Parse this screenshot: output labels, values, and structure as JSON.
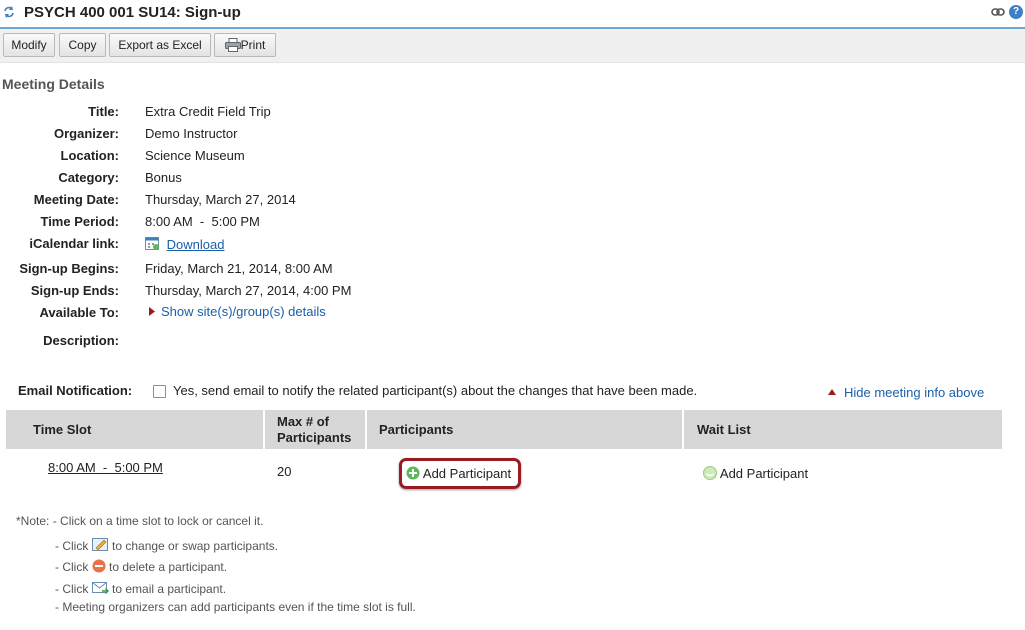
{
  "header": {
    "title": "PSYCH 400 001 SU14: Sign-up"
  },
  "toolbar": {
    "modify": "Modify",
    "copy": "Copy",
    "export": "Export as Excel",
    "print": "Print"
  },
  "details": {
    "section_title": "Meeting Details",
    "rows": [
      {
        "label": "Title:",
        "value": "Extra Credit Field Trip"
      },
      {
        "label": "Organizer:",
        "value": "Demo Instructor"
      },
      {
        "label": "Location:",
        "value": "Science Museum"
      },
      {
        "label": "Category:",
        "value": "Bonus"
      },
      {
        "label": "Meeting Date:",
        "value": "Thursday, March 27, 2014"
      },
      {
        "label": "Time Period:",
        "value": "8:00 AM  -  5:00 PM"
      },
      {
        "label": "iCalendar link:",
        "value": "Download"
      },
      {
        "label": "Sign-up Begins:",
        "value": "Friday, March 21, 2014, 8:00 AM"
      },
      {
        "label": "Sign-up Ends:",
        "value": "Thursday, March 27, 2014, 4:00 PM"
      },
      {
        "label": "Available To:",
        "value": "Show site(s)/group(s) details"
      },
      {
        "label": "Description:",
        "value": ""
      }
    ]
  },
  "email": {
    "label": "Email Notification:",
    "checkbox_text": "Yes, send email to notify the related participant(s) about the changes that have been made.",
    "checked": false
  },
  "hide_link": "Hide meeting info above",
  "table": {
    "headers": {
      "time_slot": "Time Slot",
      "max_line1": "Max # of",
      "max_line2": "Participants",
      "participants": "Participants",
      "wait_list": "Wait List"
    },
    "row": {
      "time_slot": "8:00 AM  -  5:00 PM",
      "max": "20",
      "add_participant": "Add Participant",
      "wait_add": "Add Participant"
    }
  },
  "notes": {
    "prefix": "*Note:",
    "line1": "- Click on a time slot to lock or cancel it.",
    "line2_pre": "- Click",
    "line2_post": "to change or swap participants.",
    "line3_pre": "- Click",
    "line3_post": "to delete a participant.",
    "line4_pre": "- Click",
    "line4_post": "to email a participant.",
    "line5": "- Meeting organizers can add participants even if the time slot is full."
  },
  "colors": {
    "accent_border": "#6aa6d4",
    "link": "#1a5fa8",
    "highlight_ring": "#9b1b25",
    "header_bg": "#d7d7d7"
  }
}
